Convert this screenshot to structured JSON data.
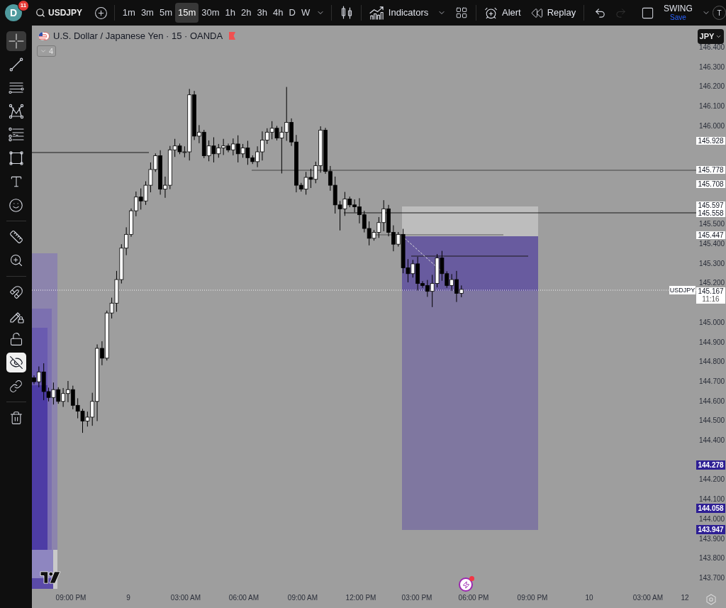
{
  "top_bar": {
    "user": {
      "initial": "D",
      "notifications": "11"
    },
    "symbol_search": {
      "value": "USDJPY"
    },
    "intervals": [
      {
        "label": "1m",
        "selected": false
      },
      {
        "label": "3m",
        "selected": false
      },
      {
        "label": "5m",
        "selected": false
      },
      {
        "label": "15m",
        "selected": true
      },
      {
        "label": "30m",
        "selected": false
      },
      {
        "label": "1h",
        "selected": false
      },
      {
        "label": "2h",
        "selected": false
      },
      {
        "label": "3h",
        "selected": false
      },
      {
        "label": "4h",
        "selected": false
      },
      {
        "label": "D",
        "selected": false
      },
      {
        "label": "W",
        "selected": false
      }
    ],
    "indicators": "Indicators",
    "alert": "Alert",
    "replay": "Replay",
    "history": [
      {
        "kind": "undo",
        "disabled": false
      },
      {
        "kind": "redo",
        "disabled": true
      }
    ],
    "layout": {
      "name": "SWING",
      "status": "Save"
    },
    "account": {
      "initial": "T"
    }
  },
  "tool_groups": [
    {
      "tools": [
        {
          "kind": "crosshair",
          "selected": true
        },
        {
          "kind": "trend_line",
          "selected": false
        },
        {
          "kind": "fib",
          "selected": false
        },
        {
          "kind": "pattern",
          "selected": false
        },
        {
          "kind": "projection",
          "selected": false
        },
        {
          "kind": "rectangle",
          "selected": false
        },
        {
          "kind": "text",
          "selected": false
        },
        {
          "kind": "emoji",
          "selected": false
        }
      ]
    },
    {
      "tools": [
        {
          "kind": "ruler",
          "selected": false
        },
        {
          "kind": "zoom",
          "selected": false
        }
      ]
    },
    {
      "tools": [
        {
          "kind": "magnet",
          "selected": false
        },
        {
          "kind": "stay_drawing",
          "selected": false
        },
        {
          "kind": "lock",
          "selected": false
        },
        {
          "kind": "hide",
          "selected": true
        },
        {
          "kind": "link",
          "selected": false
        }
      ]
    },
    {
      "tools": [
        {
          "kind": "remove",
          "selected": false
        }
      ]
    }
  ],
  "chart": {
    "title": "U.S. Dollar / Japanese Yen · 15 · OANDA",
    "indicator_count": "4",
    "currency": "JPY",
    "price_ticks": [
      "146.400",
      "146.300",
      "146.200",
      "146.100",
      "146.000",
      "145.500",
      "145.400",
      "145.300",
      "145.200",
      "145.000",
      "144.900",
      "144.800",
      "144.700",
      "144.600",
      "144.500",
      "144.400",
      "144.200",
      "144.100",
      "144.000",
      "143.900",
      "143.800",
      "143.700"
    ],
    "price_tags": [
      {
        "kind": "line",
        "value": "145.928"
      },
      {
        "kind": "line",
        "value": "145.778"
      },
      {
        "kind": "line",
        "value": "145.708"
      },
      {
        "kind": "line",
        "value": "145.597"
      },
      {
        "kind": "line",
        "value": "145.558"
      },
      {
        "kind": "line",
        "value": "145.447"
      },
      {
        "kind": "last",
        "value": "145.167",
        "countdown": "11:16"
      },
      {
        "kind": "position",
        "value": "144.278"
      },
      {
        "kind": "position",
        "value": "144.058"
      },
      {
        "kind": "position",
        "value": "143.947"
      }
    ],
    "symbol_tag": "USDJPY",
    "time_labels": [
      "09:00 PM",
      "9",
      "03:00 AM",
      "06:00 AM",
      "09:00 AM",
      "12:00 PM",
      "03:00 PM",
      "06:00 PM",
      "09:00 PM",
      "10",
      "03:00 AM",
      "12"
    ]
  }
}
